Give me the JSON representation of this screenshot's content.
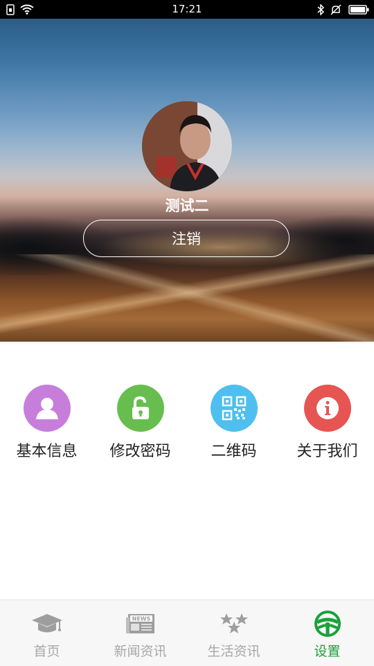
{
  "status_bar": {
    "time": "17:21",
    "icons": [
      "sim-card-icon",
      "wifi-icon",
      "bluetooth-icon",
      "mute-icon",
      "battery-icon"
    ]
  },
  "profile": {
    "username": "测试二",
    "logout_label": "注销"
  },
  "menu": {
    "items": [
      {
        "label": "基本信息",
        "icon": "user-icon",
        "color": "#c77edb"
      },
      {
        "label": "修改密码",
        "icon": "unlock-icon",
        "color": "#68bd4f"
      },
      {
        "label": "二维码",
        "icon": "qrcode-icon",
        "color": "#4ebfef"
      },
      {
        "label": "关于我们",
        "icon": "info-icon",
        "color": "#e65552"
      }
    ]
  },
  "bottom_nav": {
    "items": [
      {
        "label": "首页",
        "icon": "graduation-cap-icon",
        "active": false
      },
      {
        "label": "新闻资讯",
        "icon": "newspaper-icon",
        "active": false
      },
      {
        "label": "生活资讯",
        "icon": "stars-icon",
        "active": false
      },
      {
        "label": "设置",
        "icon": "steering-wheel-icon",
        "active": true
      }
    ],
    "active_color": "#1aa13a",
    "inactive_color": "#a7a7a7",
    "newspaper_badge": "NEWS"
  }
}
